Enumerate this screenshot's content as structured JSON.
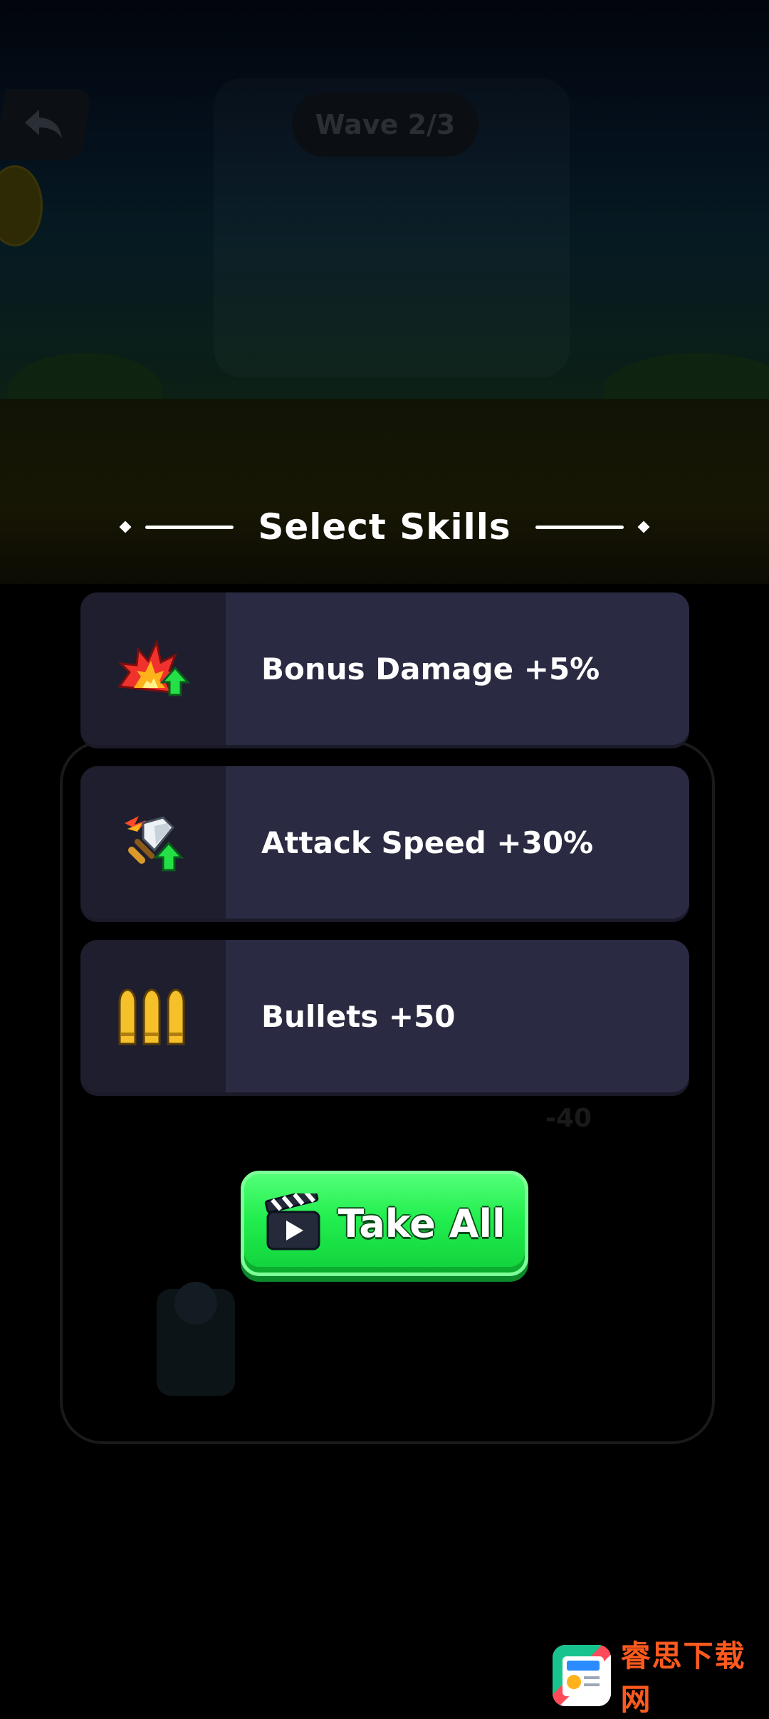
{
  "hud": {
    "wave_label": "Wave 2/3"
  },
  "background_text": {
    "damage_value": "-40"
  },
  "dialog": {
    "title": "Select Skills",
    "skills": [
      {
        "icon": "explosion-damage-up-icon",
        "label": "Bonus Damage +5%"
      },
      {
        "icon": "flaming-sword-speed-up-icon",
        "label": "Attack Speed +30%"
      },
      {
        "icon": "bullets-icon",
        "label": "Bullets +50"
      }
    ],
    "take_all": {
      "icon": "clapperboard-video-icon",
      "label": "Take All"
    }
  },
  "watermark": {
    "text": "睿思下载网"
  },
  "colors": {
    "card_bg": "#2a2a42",
    "card_icon_bg": "#1e1e2e",
    "button_green": "#22ee4e",
    "watermark_orange": "#ff5a1e"
  }
}
